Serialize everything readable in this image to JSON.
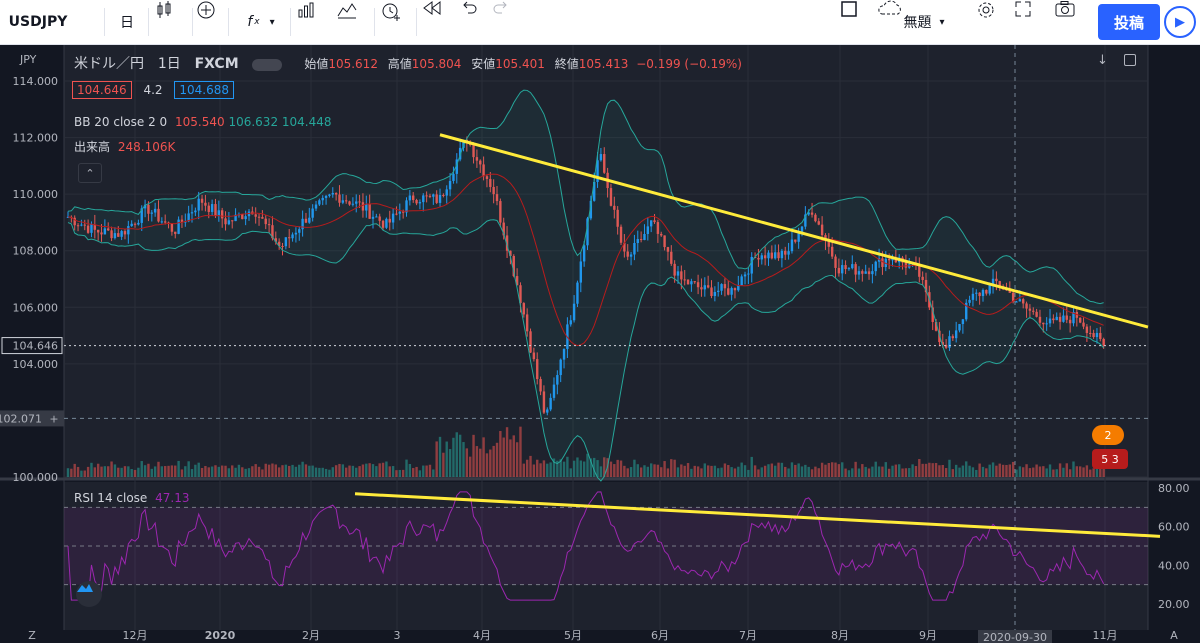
{
  "toolbar": {
    "symbol": "USDJPY",
    "interval": "日",
    "fx": "f",
    "layout_name": "無題",
    "post": "投稿"
  },
  "legend": {
    "title": "米ドル／円",
    "interval": "1日",
    "source": "FXCM",
    "open_label": "始値",
    "open": "105.612",
    "high_label": "高値",
    "high": "105.804",
    "low_label": "安値",
    "low": "105.401",
    "close_label": "終値",
    "close": "105.413",
    "change": "−0.199 (−0.19%)",
    "bid": "104.646",
    "spread": "4.2",
    "ask": "104.688",
    "bb_label": "BB 20 close 2 0",
    "bb_mid": "105.540",
    "bb_upper": "106.632",
    "bb_lower": "104.448",
    "vol_label": "出来高",
    "vol_value": "248.106K",
    "rsi_label": "RSI 14 close",
    "rsi_value": "47.13"
  },
  "axis": {
    "currency": "JPY",
    "price_ticks": [
      "114.000",
      "112.000",
      "110.000",
      "108.000",
      "106.000",
      "104.000",
      "100.000"
    ],
    "last_price": "104.646",
    "crosshair_price": "102.071",
    "rsi_ticks": [
      "80.00",
      "60.00",
      "40.00",
      "20.00"
    ],
    "time_ticks": [
      "12月",
      "2020",
      "2月",
      "3",
      "4月",
      "5月",
      "6月",
      "7月",
      "8月",
      "9月",
      "11月"
    ],
    "crosshair_date": "2020-09-30",
    "tz": "Z",
    "autoscale": "A"
  },
  "chart_data": {
    "type": "candlestick",
    "title": "米ドル／円 1日 FXCM",
    "series": [
      {
        "name": "USDJPY",
        "approx_closes": [
          109.2,
          108.7,
          108.6,
          109.5,
          108.7,
          109.8,
          109.0,
          109.5,
          108.1,
          109.2,
          110.0,
          109.6,
          108.9,
          109.9,
          109.8,
          112.0,
          110.2,
          106.5,
          102.0,
          106.0,
          111.5,
          107.6,
          109.0,
          107.0,
          106.6,
          106.6,
          107.9,
          107.8,
          109.5,
          107.4,
          107.3,
          107.8,
          107.3,
          104.4,
          106.3,
          106.9,
          106.0,
          105.4,
          105.7,
          104.6
        ]
      }
    ],
    "y_range": [
      100,
      114
    ],
    "rsi_range": [
      20,
      80
    ],
    "annotations": [
      "trendline-price",
      "trendline-rsi"
    ]
  },
  "colors": {
    "up": "#26a69a",
    "up_candle": "#2196f3",
    "down": "#ef5350",
    "bb": "#26a69a",
    "trendline": "#ffeb3b",
    "rsi": "#9c27b0"
  }
}
